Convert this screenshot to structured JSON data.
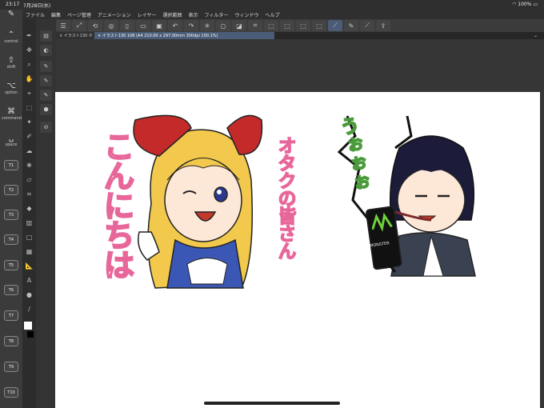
{
  "status": {
    "time": "23:17",
    "date": "7月28日(水)",
    "battery": "100%"
  },
  "menu": [
    "ファイル",
    "編集",
    "ページ管理",
    "アニメーション",
    "レイヤー",
    "選択範囲",
    "表示",
    "フィルター",
    "ウィンドウ",
    "ヘルプ"
  ],
  "tabs": [
    {
      "label": "イラスト130 ©"
    },
    {
      "label": "イラスト130 108 (A4 210.00 x 297.00mm 300dpi 100.1%)"
    }
  ],
  "shortcuts": {
    "control": "control",
    "shift": "shift",
    "option": "option",
    "command": "command",
    "space": "space",
    "keys": [
      "T1",
      "T2",
      "T3",
      "T4",
      "T5",
      "T6",
      "T7",
      "T8",
      "T9",
      "T10"
    ]
  },
  "artwork": {
    "left_vertical": "こんにちは",
    "middle_vertical": "オタクの皆さん",
    "right_text": "うぉぉぉ",
    "can_label": "MONSTER"
  },
  "colors": {
    "pink": "#e8679b",
    "green": "#4a9a3a",
    "hair_blonde": "#f2c94c",
    "bow_red": "#c42a2a",
    "hair_dark": "#1c1c3a",
    "canvas": "#ffffff"
  }
}
